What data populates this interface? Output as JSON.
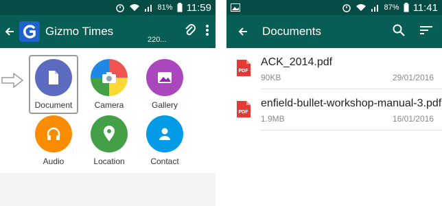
{
  "left": {
    "status": {
      "battery": "81%",
      "time": "11:59"
    },
    "appbar": {
      "title": "Gizmo Times",
      "subtitle": "220..."
    },
    "attach_items": [
      {
        "label": "Document",
        "color": "#5c6bc0",
        "icon": "document-icon"
      },
      {
        "label": "Camera",
        "color": "#ef5350",
        "icon": "camera-icon"
      },
      {
        "label": "Gallery",
        "color": "#ab47bc",
        "icon": "gallery-icon"
      },
      {
        "label": "Audio",
        "color": "#fb8c00",
        "icon": "headphones-icon"
      },
      {
        "label": "Location",
        "color": "#43a047",
        "icon": "location-icon"
      },
      {
        "label": "Contact",
        "color": "#039be5",
        "icon": "contact-icon"
      }
    ]
  },
  "right": {
    "status": {
      "battery": "87%",
      "time": "11:41"
    },
    "appbar": {
      "title": "Documents"
    },
    "documents": [
      {
        "name": "ACK_2014.pdf",
        "size": "90KB",
        "date": "29/01/2016",
        "badge": "PDF"
      },
      {
        "name": "enfield-bullet-workshop-manual-3.pdf",
        "size": "1.9MB",
        "date": "16/01/2016",
        "badge": "PDF"
      }
    ]
  },
  "colors": {
    "appbar": "#075e54",
    "statusbar": "#054d44",
    "pdf_red": "#e53935"
  }
}
